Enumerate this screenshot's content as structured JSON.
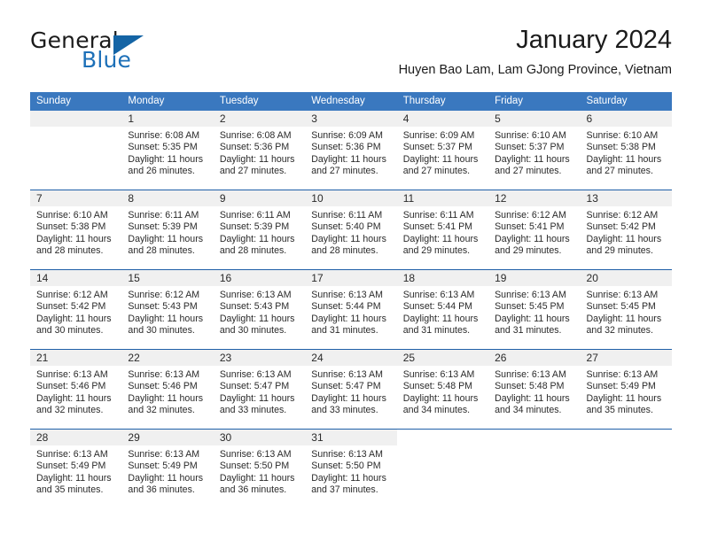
{
  "brand": {
    "word_general": "General",
    "word_blue": "Blue",
    "triangle_color": "#1464a5"
  },
  "header": {
    "title": "January 2024",
    "subtitle": "Huyen Bao Lam, Lam GJong Province, Vietnam"
  },
  "theme": {
    "header_bar": "#3a78bf",
    "row_divider": "#1f5fa8",
    "day_number_band": "#f0f0f0",
    "text": "#2a2a2a"
  },
  "calendar": {
    "weekday_headers": [
      "Sunday",
      "Monday",
      "Tuesday",
      "Wednesday",
      "Thursday",
      "Friday",
      "Saturday"
    ],
    "weeks": [
      [
        {
          "day": "",
          "sunrise": "",
          "sunset": "",
          "daylight": "",
          "empty": true
        },
        {
          "day": "1",
          "sunrise": "Sunrise: 6:08 AM",
          "sunset": "Sunset: 5:35 PM",
          "daylight": "Daylight: 11 hours and 26 minutes."
        },
        {
          "day": "2",
          "sunrise": "Sunrise: 6:08 AM",
          "sunset": "Sunset: 5:36 PM",
          "daylight": "Daylight: 11 hours and 27 minutes."
        },
        {
          "day": "3",
          "sunrise": "Sunrise: 6:09 AM",
          "sunset": "Sunset: 5:36 PM",
          "daylight": "Daylight: 11 hours and 27 minutes."
        },
        {
          "day": "4",
          "sunrise": "Sunrise: 6:09 AM",
          "sunset": "Sunset: 5:37 PM",
          "daylight": "Daylight: 11 hours and 27 minutes."
        },
        {
          "day": "5",
          "sunrise": "Sunrise: 6:10 AM",
          "sunset": "Sunset: 5:37 PM",
          "daylight": "Daylight: 11 hours and 27 minutes."
        },
        {
          "day": "6",
          "sunrise": "Sunrise: 6:10 AM",
          "sunset": "Sunset: 5:38 PM",
          "daylight": "Daylight: 11 hours and 27 minutes."
        }
      ],
      [
        {
          "day": "7",
          "sunrise": "Sunrise: 6:10 AM",
          "sunset": "Sunset: 5:38 PM",
          "daylight": "Daylight: 11 hours and 28 minutes."
        },
        {
          "day": "8",
          "sunrise": "Sunrise: 6:11 AM",
          "sunset": "Sunset: 5:39 PM",
          "daylight": "Daylight: 11 hours and 28 minutes."
        },
        {
          "day": "9",
          "sunrise": "Sunrise: 6:11 AM",
          "sunset": "Sunset: 5:39 PM",
          "daylight": "Daylight: 11 hours and 28 minutes."
        },
        {
          "day": "10",
          "sunrise": "Sunrise: 6:11 AM",
          "sunset": "Sunset: 5:40 PM",
          "daylight": "Daylight: 11 hours and 28 minutes."
        },
        {
          "day": "11",
          "sunrise": "Sunrise: 6:11 AM",
          "sunset": "Sunset: 5:41 PM",
          "daylight": "Daylight: 11 hours and 29 minutes."
        },
        {
          "day": "12",
          "sunrise": "Sunrise: 6:12 AM",
          "sunset": "Sunset: 5:41 PM",
          "daylight": "Daylight: 11 hours and 29 minutes."
        },
        {
          "day": "13",
          "sunrise": "Sunrise: 6:12 AM",
          "sunset": "Sunset: 5:42 PM",
          "daylight": "Daylight: 11 hours and 29 minutes."
        }
      ],
      [
        {
          "day": "14",
          "sunrise": "Sunrise: 6:12 AM",
          "sunset": "Sunset: 5:42 PM",
          "daylight": "Daylight: 11 hours and 30 minutes."
        },
        {
          "day": "15",
          "sunrise": "Sunrise: 6:12 AM",
          "sunset": "Sunset: 5:43 PM",
          "daylight": "Daylight: 11 hours and 30 minutes."
        },
        {
          "day": "16",
          "sunrise": "Sunrise: 6:13 AM",
          "sunset": "Sunset: 5:43 PM",
          "daylight": "Daylight: 11 hours and 30 minutes."
        },
        {
          "day": "17",
          "sunrise": "Sunrise: 6:13 AM",
          "sunset": "Sunset: 5:44 PM",
          "daylight": "Daylight: 11 hours and 31 minutes."
        },
        {
          "day": "18",
          "sunrise": "Sunrise: 6:13 AM",
          "sunset": "Sunset: 5:44 PM",
          "daylight": "Daylight: 11 hours and 31 minutes."
        },
        {
          "day": "19",
          "sunrise": "Sunrise: 6:13 AM",
          "sunset": "Sunset: 5:45 PM",
          "daylight": "Daylight: 11 hours and 31 minutes."
        },
        {
          "day": "20",
          "sunrise": "Sunrise: 6:13 AM",
          "sunset": "Sunset: 5:45 PM",
          "daylight": "Daylight: 11 hours and 32 minutes."
        }
      ],
      [
        {
          "day": "21",
          "sunrise": "Sunrise: 6:13 AM",
          "sunset": "Sunset: 5:46 PM",
          "daylight": "Daylight: 11 hours and 32 minutes."
        },
        {
          "day": "22",
          "sunrise": "Sunrise: 6:13 AM",
          "sunset": "Sunset: 5:46 PM",
          "daylight": "Daylight: 11 hours and 32 minutes."
        },
        {
          "day": "23",
          "sunrise": "Sunrise: 6:13 AM",
          "sunset": "Sunset: 5:47 PM",
          "daylight": "Daylight: 11 hours and 33 minutes."
        },
        {
          "day": "24",
          "sunrise": "Sunrise: 6:13 AM",
          "sunset": "Sunset: 5:47 PM",
          "daylight": "Daylight: 11 hours and 33 minutes."
        },
        {
          "day": "25",
          "sunrise": "Sunrise: 6:13 AM",
          "sunset": "Sunset: 5:48 PM",
          "daylight": "Daylight: 11 hours and 34 minutes."
        },
        {
          "day": "26",
          "sunrise": "Sunrise: 6:13 AM",
          "sunset": "Sunset: 5:48 PM",
          "daylight": "Daylight: 11 hours and 34 minutes."
        },
        {
          "day": "27",
          "sunrise": "Sunrise: 6:13 AM",
          "sunset": "Sunset: 5:49 PM",
          "daylight": "Daylight: 11 hours and 35 minutes."
        }
      ],
      [
        {
          "day": "28",
          "sunrise": "Sunrise: 6:13 AM",
          "sunset": "Sunset: 5:49 PM",
          "daylight": "Daylight: 11 hours and 35 minutes."
        },
        {
          "day": "29",
          "sunrise": "Sunrise: 6:13 AM",
          "sunset": "Sunset: 5:49 PM",
          "daylight": "Daylight: 11 hours and 36 minutes."
        },
        {
          "day": "30",
          "sunrise": "Sunrise: 6:13 AM",
          "sunset": "Sunset: 5:50 PM",
          "daylight": "Daylight: 11 hours and 36 minutes."
        },
        {
          "day": "31",
          "sunrise": "Sunrise: 6:13 AM",
          "sunset": "Sunset: 5:50 PM",
          "daylight": "Daylight: 11 hours and 37 minutes."
        },
        {
          "day": "",
          "sunrise": "",
          "sunset": "",
          "daylight": "",
          "empty": true,
          "no_band": true
        },
        {
          "day": "",
          "sunrise": "",
          "sunset": "",
          "daylight": "",
          "empty": true,
          "no_band": true
        },
        {
          "day": "",
          "sunrise": "",
          "sunset": "",
          "daylight": "",
          "empty": true,
          "no_band": true
        }
      ]
    ]
  }
}
